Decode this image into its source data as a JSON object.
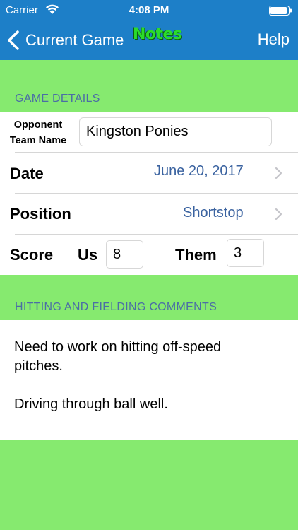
{
  "status_bar": {
    "carrier": "Carrier",
    "time": "4:08 PM",
    "wifi_icon": "wifi-icon",
    "battery_icon": "battery-icon"
  },
  "nav": {
    "back_label": "Current Game",
    "title": "Notes",
    "help_label": "Help",
    "back_icon": "chevron-left-icon"
  },
  "colors": {
    "nav_bg": "#1d7fc8",
    "page_bg": "#86ea6f",
    "title_green": "#2bdc2b",
    "value_blue": "#3b63a0"
  },
  "game_details": {
    "header": "GAME DETAILS",
    "opponent_label_line1": "Opponent",
    "opponent_label_line2": "Team Name",
    "opponent_value": "Kingston Ponies",
    "date_label": "Date",
    "date_value": "June 20, 2017",
    "position_label": "Position",
    "position_value": "Shortstop",
    "score_label": "Score",
    "us_label": "Us",
    "us_value": "8",
    "them_label": "Them",
    "them_value": "3"
  },
  "comments": {
    "header": "HITTING AND FIELDING COMMENTS",
    "text": "Need to work on hitting off-speed\npitches.\n\nDriving through ball well."
  }
}
